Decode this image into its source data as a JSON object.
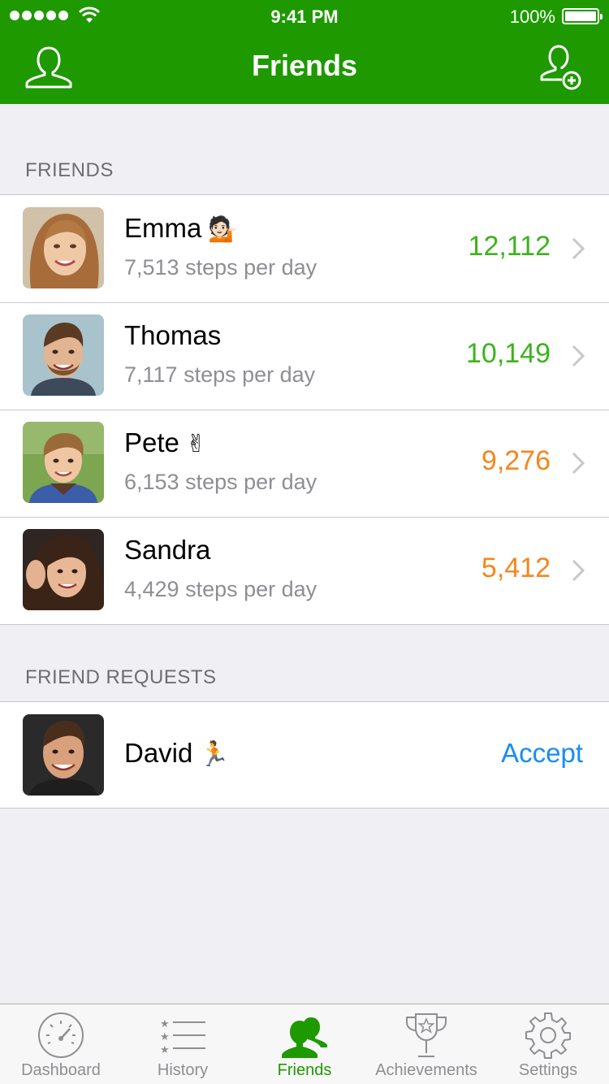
{
  "status_bar": {
    "time": "9:41 PM",
    "battery": "100%"
  },
  "nav": {
    "title": "Friends",
    "left_icon": "profile-icon",
    "right_icon": "add-friend-icon"
  },
  "friends_section": {
    "header": "FRIENDS",
    "items": [
      {
        "name": "Emma",
        "emoji": "💁🏻",
        "subtitle": "7,513 steps per day",
        "count": "12,112",
        "count_color": "#3cb31e"
      },
      {
        "name": "Thomas",
        "emoji": "",
        "subtitle": "7,117 steps per day",
        "count": "10,149",
        "count_color": "#3cb31e"
      },
      {
        "name": "Pete",
        "emoji": "✌",
        "subtitle": "6,153 steps per day",
        "count": "9,276",
        "count_color": "#f5861f"
      },
      {
        "name": "Sandra",
        "emoji": "",
        "subtitle": "4,429 steps per day",
        "count": "5,412",
        "count_color": "#f5861f"
      }
    ]
  },
  "requests_section": {
    "header": "FRIEND REQUESTS",
    "items": [
      {
        "name": "David",
        "emoji": "🏃",
        "action": "Accept"
      }
    ]
  },
  "tabbar": {
    "tabs": [
      {
        "label": "Dashboard",
        "icon": "speedometer-icon",
        "active": false
      },
      {
        "label": "History",
        "icon": "star-list-icon",
        "active": false
      },
      {
        "label": "Friends",
        "icon": "friends-icon",
        "active": true
      },
      {
        "label": "Achievements",
        "icon": "trophy-icon",
        "active": false
      },
      {
        "label": "Settings",
        "icon": "gear-icon",
        "active": false
      }
    ]
  },
  "colors": {
    "brand_green": "#1e9900",
    "positive": "#3cb31e",
    "warning": "#f5861f",
    "link": "#1a8cf5"
  }
}
